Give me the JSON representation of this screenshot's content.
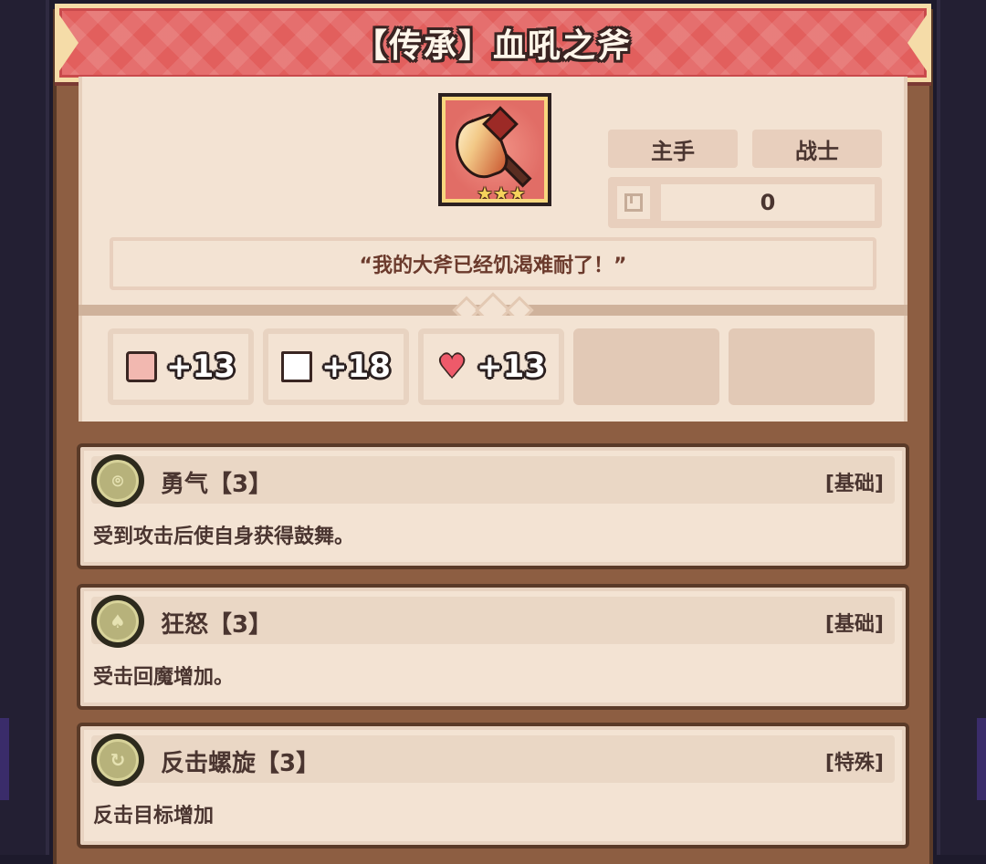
{
  "item": {
    "title": "【传承】血吼之斧",
    "icon": "battle-axe-icon",
    "stars": [
      "★",
      "★",
      "★"
    ],
    "slot": "主手",
    "class": "战士",
    "level_icon": "enhance-icon",
    "level_value": "0",
    "quote": "“我的大斧已经饥渴难耐了！”"
  },
  "stats": [
    {
      "icon": "strength-icon",
      "value": "+13"
    },
    {
      "icon": "intellect-icon",
      "value": "+18"
    },
    {
      "icon": "heart-icon",
      "value": "+13"
    }
  ],
  "skills": [
    {
      "icon": "courage-skill-icon",
      "glyph": "⌾",
      "name": "勇气【3】",
      "type": "[基础]",
      "desc": "受到攻击后使自身获得鼓舞。"
    },
    {
      "icon": "rage-skill-icon",
      "glyph": "♠",
      "name": "狂怒【3】",
      "type": "[基础]",
      "desc": "受击回魔增加。"
    },
    {
      "icon": "counter-spiral-skill-icon",
      "glyph": "↻",
      "name": "反击螺旋【3】",
      "type": "[特殊]",
      "desc": "反击目标增加"
    }
  ],
  "colors": {
    "banner": "#e25f5d",
    "panel": "#f3e3d3",
    "text": "#4a3530",
    "quote_text": "#6b3a2c"
  }
}
